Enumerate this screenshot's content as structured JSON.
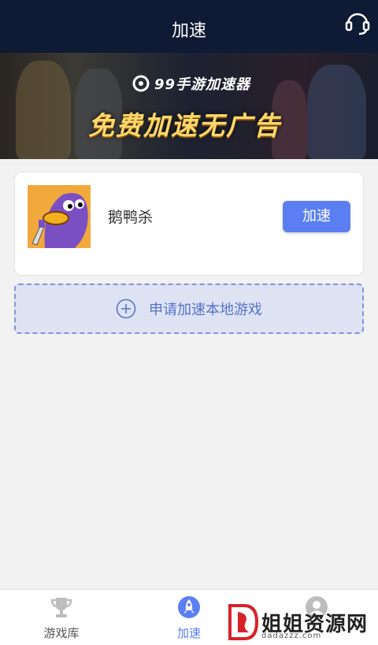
{
  "header": {
    "title": "加速",
    "support_icon": "headset-icon"
  },
  "banner": {
    "brand": "99手游加速器",
    "slogan": "免费加速无广告"
  },
  "game_card": {
    "name": "鹅鸭杀",
    "button_label": "加速",
    "accent_color": "#5b7ff2"
  },
  "apply": {
    "label": "申请加速本地游戏",
    "icon": "plus-circle-icon"
  },
  "tabs": [
    {
      "label": "游戏库",
      "icon": "trophy-icon",
      "active": false
    },
    {
      "label": "加速",
      "icon": "rocket-icon",
      "active": true
    },
    {
      "label": "",
      "icon": "user-icon",
      "active": false
    }
  ],
  "watermark": {
    "text": "姐姐资源网",
    "sub": "dadazzz.com"
  }
}
